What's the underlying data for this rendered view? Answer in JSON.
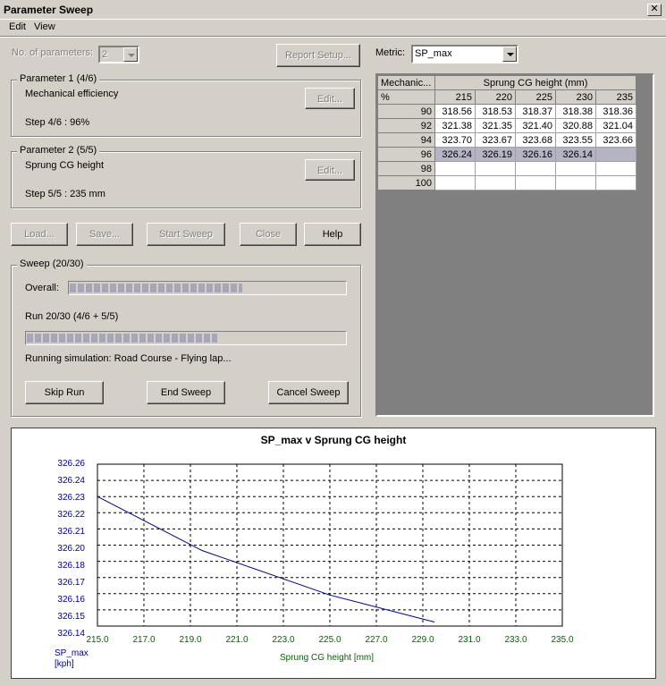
{
  "window": {
    "title": "Parameter Sweep",
    "close_glyph": "✕"
  },
  "menu": [
    {
      "label": "Edit",
      "accel": "E"
    },
    {
      "label": "View",
      "accel": "V"
    }
  ],
  "controls": {
    "num_params_label": "No. of parameters:",
    "num_params_value": "2",
    "report_setup": "Report Setup...",
    "metric_label": "Metric:",
    "metric_value": "SP_max"
  },
  "param1": {
    "title": "Parameter 1 (4/6)",
    "name": "Mechanical efficiency",
    "edit": "Edit...",
    "step": "Step 4/6 : 96%"
  },
  "param2": {
    "title": "Parameter 2 (5/5)",
    "name": "Sprung CG height",
    "edit": "Edit...",
    "step": "Step 5/5 : 235 mm"
  },
  "buttons": {
    "load": "Load...",
    "save": "Save...",
    "start": "Start Sweep",
    "close": "Close",
    "help": "Help"
  },
  "sweep": {
    "title": "Sweep (20/30)",
    "overall_label": "Overall:",
    "overall_progress": 0.63,
    "run_label": "Run 20/30 (4/6 + 5/5)",
    "run_progress": 0.6,
    "status": "Running simulation: Road Course - Flying lap...",
    "skip_run": "Skip Run",
    "end_sweep": "End Sweep",
    "cancel_sweep": "Cancel Sweep"
  },
  "grid": {
    "corner_top": "Mechanic...",
    "corner_unit": "%",
    "col_group": "Sprung CG height (mm)",
    "columns": [
      "215",
      "220",
      "225",
      "230",
      "235"
    ],
    "rows": [
      {
        "label": "90",
        "values": [
          "318.56",
          "318.53",
          "318.37",
          "318.38",
          "318.36"
        ],
        "selected": false
      },
      {
        "label": "92",
        "values": [
          "321.38",
          "321.35",
          "321.40",
          "320.88",
          "321.04"
        ],
        "selected": false
      },
      {
        "label": "94",
        "values": [
          "323.70",
          "323.67",
          "323.68",
          "323.55",
          "323.66"
        ],
        "selected": false
      },
      {
        "label": "96",
        "values": [
          "326.24",
          "326.19",
          "326.16",
          "326.14",
          ""
        ],
        "selected": true
      },
      {
        "label": "98",
        "values": [
          "",
          "",
          "",
          "",
          ""
        ],
        "selected": false
      },
      {
        "label": "100",
        "values": [
          "",
          "",
          "",
          "",
          ""
        ],
        "selected": false
      }
    ]
  },
  "chart_data": {
    "type": "line",
    "title": "SP_max v Sprung CG height",
    "xlabel": "Sprung CG height [mm]",
    "ylabel": "SP_max",
    "yunit": "[kph]",
    "xlim": [
      215.0,
      235.0
    ],
    "ylim": [
      326.14,
      326.26
    ],
    "xticks": [
      "215.0",
      "217.0",
      "219.0",
      "221.0",
      "223.0",
      "225.0",
      "227.0",
      "229.0",
      "231.0",
      "233.0",
      "235.0"
    ],
    "yticks": [
      "326.26",
      "326.24",
      "326.23",
      "326.22",
      "326.21",
      "326.20",
      "326.18",
      "326.17",
      "326.16",
      "326.15",
      "326.14"
    ],
    "grid": true,
    "line_color": "#00008b",
    "series": [
      {
        "x": [
          215.0,
          219.5,
          225.0,
          229.5
        ],
        "values": [
          326.236,
          326.196,
          326.163,
          326.143
        ]
      }
    ]
  }
}
